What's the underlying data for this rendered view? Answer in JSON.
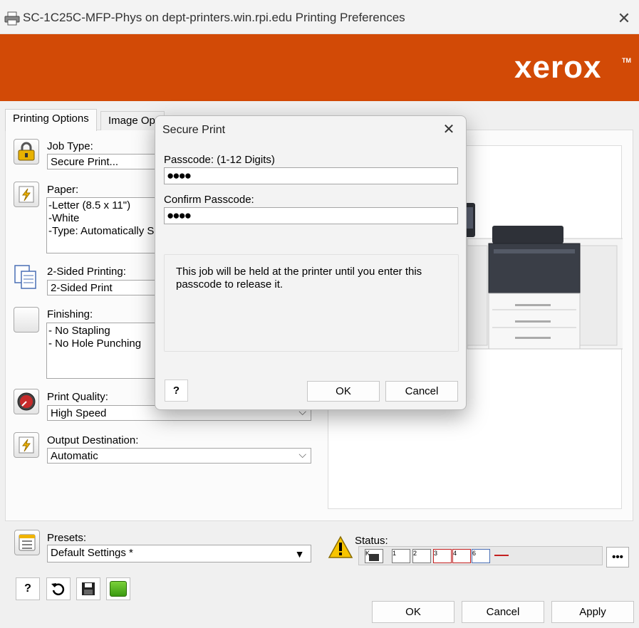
{
  "window": {
    "title": "SC-1C25C-MFP-Phys on dept-printers.win.rpi.edu Printing Preferences",
    "close_glyph": "✕"
  },
  "brand": {
    "logo": "xerox",
    "tm": "TM",
    "color": "#d24a06"
  },
  "tabs": [
    {
      "label": "Printing Options"
    },
    {
      "label": "Image Opt"
    }
  ],
  "options": {
    "job_type": {
      "label": "Job Type:",
      "value": "Secure Print..."
    },
    "paper": {
      "label": "Paper:",
      "lines": [
        "-Letter (8.5 x 11\")",
        "-White",
        "-Type: Automatically S"
      ]
    },
    "two_sided": {
      "label": "2-Sided Printing:",
      "value": "2-Sided Print"
    },
    "finishing": {
      "label": "Finishing:",
      "lines": [
        "- No Stapling",
        "- No Hole Punching"
      ]
    },
    "print_quality": {
      "label": "Print Quality:",
      "value": "High Speed"
    },
    "output_destination": {
      "label": "Output Destination:",
      "value": "Automatic"
    }
  },
  "presets": {
    "label": "Presets:",
    "value": "Default Settings *"
  },
  "status": {
    "label": "Status:",
    "trays": [
      "K",
      "1",
      "2",
      "3",
      "4",
      "6"
    ],
    "more_label": "•••"
  },
  "buttons": {
    "ok": "OK",
    "cancel": "Cancel",
    "apply": "Apply"
  },
  "modal": {
    "title": "Secure Print",
    "passcode_label": "Passcode: (1-12 Digits)",
    "passcode_value": "●●●●",
    "confirm_label": "Confirm Passcode:",
    "confirm_value": "●●●●",
    "info": "This job will be held at the printer until you enter this passcode to release it.",
    "help": "?",
    "ok": "OK",
    "cancel": "Cancel"
  }
}
